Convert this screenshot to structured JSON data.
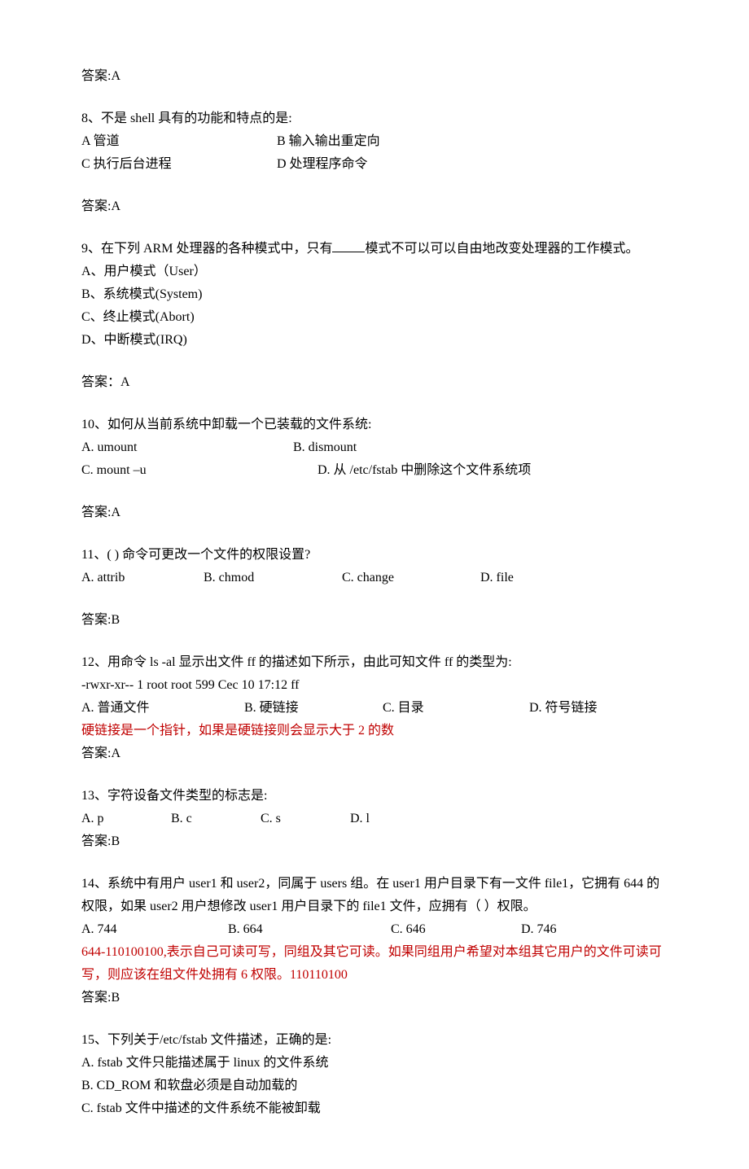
{
  "q7": {
    "answer_label": "答案:A"
  },
  "q8": {
    "stem": "8、不是 shell 具有的功能和特点的是:",
    "optA": "A 管道",
    "optB": "B 输入输出重定向",
    "optC": "C 执行后台进程",
    "optD": "D 处理程序命令",
    "answer_label": "答案:A"
  },
  "q9": {
    "stem_pre": "9、在下列 ARM 处理器的各种模式中，只有",
    "stem_post": "模式不可以可以自由地改变处理器的工作模式。",
    "optA": "A、用户模式（User）",
    "optB": "B、系统模式(System)",
    "optC": "C、终止模式(Abort)",
    "optD": "D、中断模式(IRQ)",
    "answer_label": "答案：A"
  },
  "q10": {
    "stem": "10、如何从当前系统中卸载一个已装载的文件系统:",
    "optA": "A. umount",
    "optB": "B. dismount",
    "optC": "C. mount –u",
    "optD": "D. 从 /etc/fstab 中删除这个文件系统项",
    "answer_label": "答案:A"
  },
  "q11": {
    "stem": "11、( ) 命令可更改一个文件的权限设置?",
    "optA": "A. attrib",
    "optB": "B. chmod",
    "optC": "C. change",
    "optD": "D. file",
    "answer_label": "答案:B"
  },
  "q12": {
    "stem": "12、用命令 ls -al 显示出文件 ff 的描述如下所示，由此可知文件 ff 的类型为:",
    "listing": "-rwxr-xr-- 1 root root 599 Cec 10 17:12 ff",
    "optA": "A. 普通文件",
    "optB": "B. 硬链接",
    "optC": "C. 目录",
    "optD": "D. 符号链接",
    "note": "硬链接是一个指针，如果是硬链接则会显示大于 2 的数",
    "answer_label": "答案:A"
  },
  "q13": {
    "stem": "13、字符设备文件类型的标志是:",
    "optA": "A. p",
    "optB": "B. c",
    "optC": "C. s",
    "optD": "D. l",
    "answer_label": "答案:B"
  },
  "q14": {
    "stem": "14、系统中有用户 user1 和 user2，同属于 users 组。在 user1 用户目录下有一文件 file1，它拥有 644 的权限，如果 user2 用户想修改 user1 用户目录下的 file1 文件，应拥有（ ）权限。",
    "optA": "A. 744",
    "optB": "B. 664",
    "optC": "C. 646",
    "optD": "D. 746",
    "note": "644-110100100,表示自己可读可写，同组及其它可读。如果同组用户希望对本组其它用户的文件可读可写，则应该在组文件处拥有 6 权限。110110100",
    "answer_label": "答案:B"
  },
  "q15": {
    "stem": "15、下列关于/etc/fstab 文件描述，正确的是:",
    "optA": "A. fstab 文件只能描述属于 linux 的文件系统",
    "optB": "B. CD_ROM 和软盘必须是自动加载的",
    "optC": "C. fstab 文件中描述的文件系统不能被卸载"
  }
}
